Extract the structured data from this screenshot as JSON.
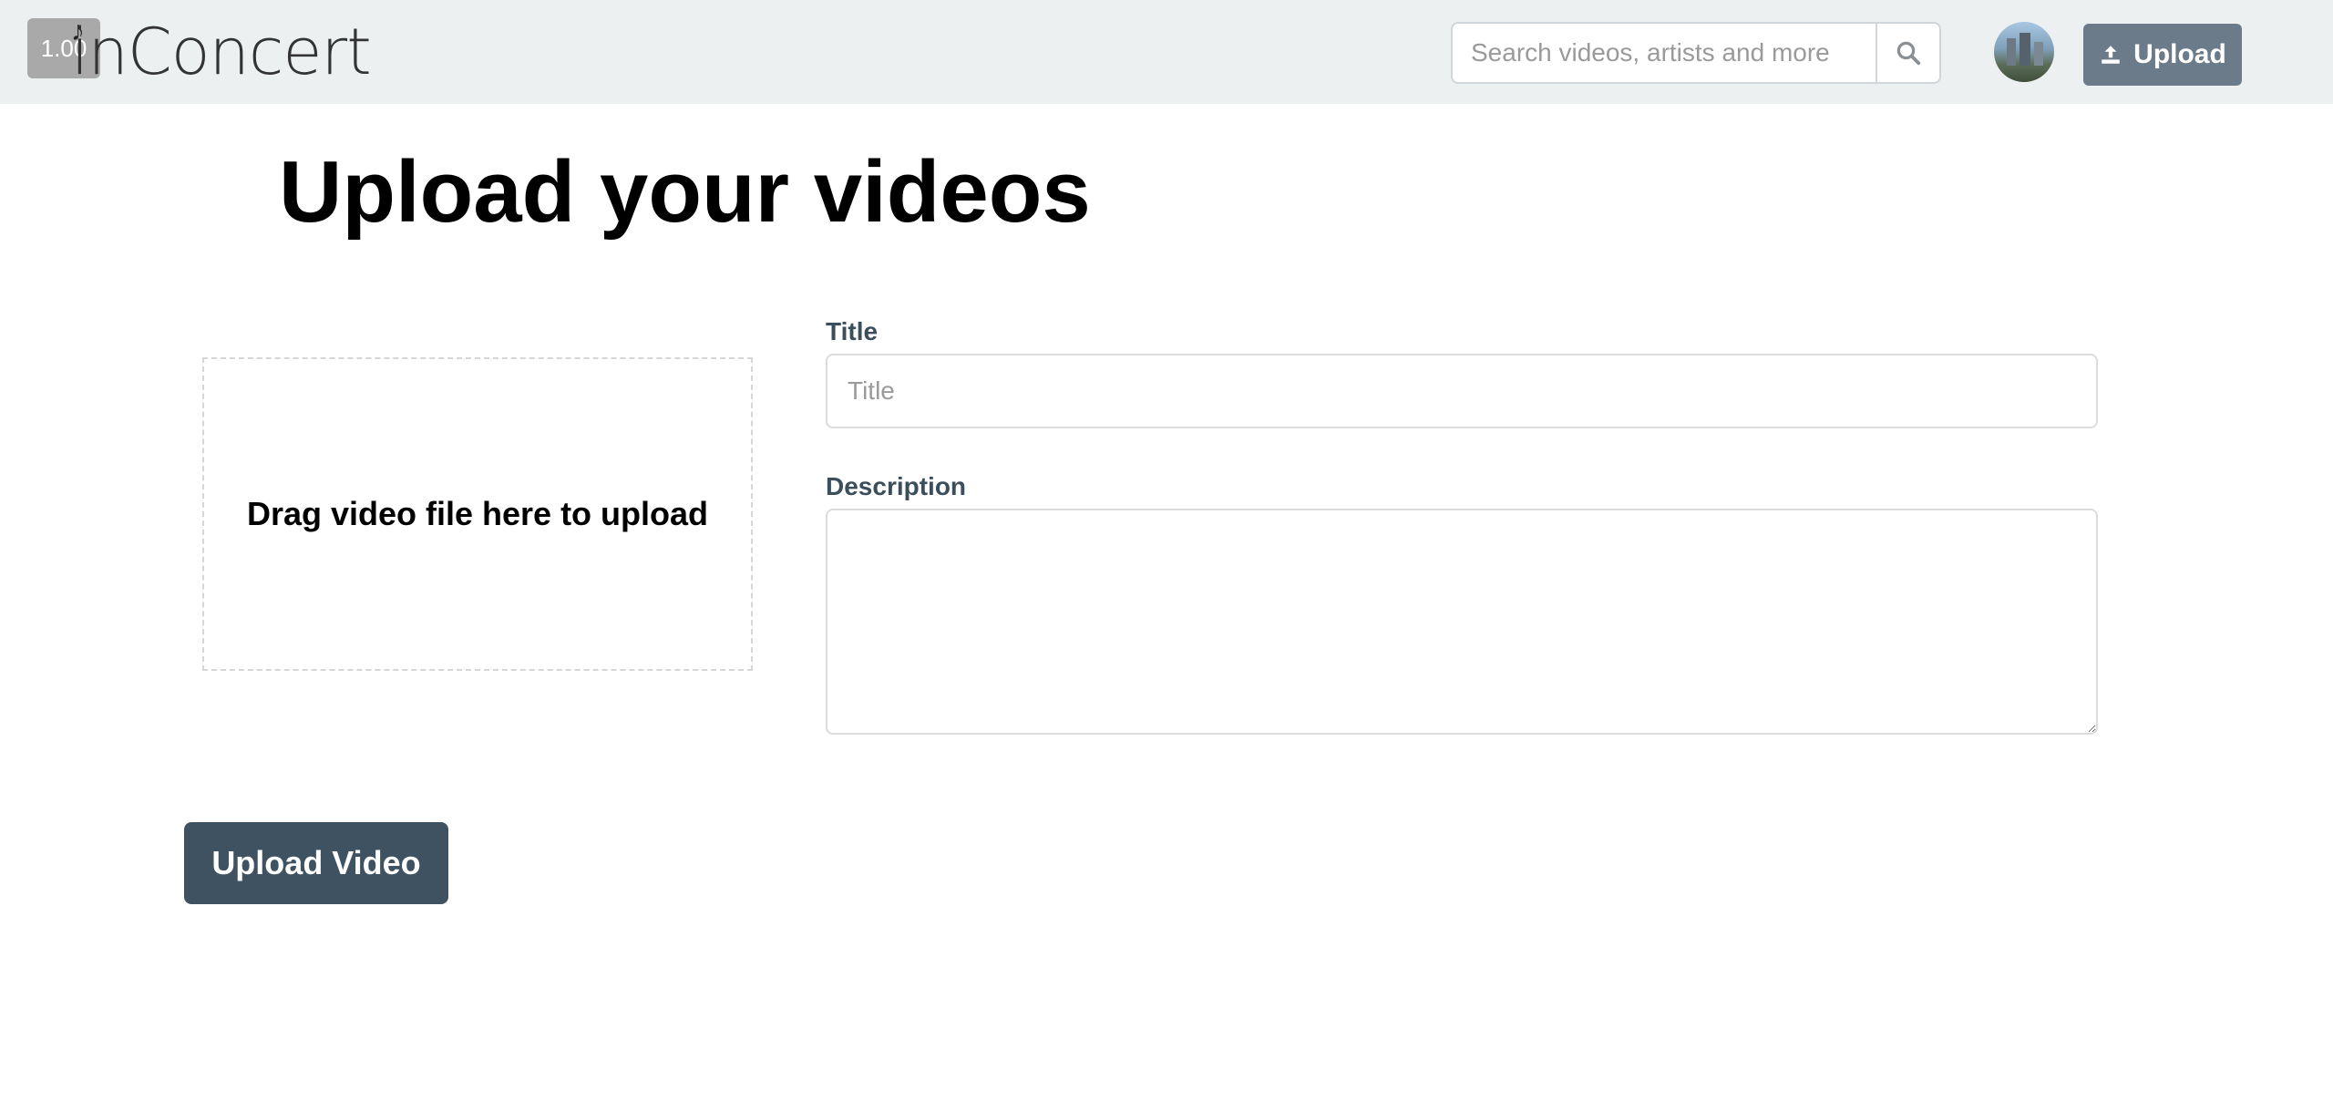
{
  "header": {
    "logo_badge": "1.00",
    "logo_text": "inConcert",
    "logo_icon": "music-note-icon",
    "search": {
      "placeholder": "Search videos, artists and more",
      "value": "",
      "icon": "search-icon"
    },
    "avatar_icon": "user-avatar",
    "upload_button": {
      "label": "Upload",
      "icon": "upload-icon"
    }
  },
  "main": {
    "title": "Upload your videos",
    "dropzone_text": "Drag video file here to upload",
    "form": {
      "title_label": "Title",
      "title_placeholder": "Title",
      "title_value": "",
      "description_label": "Description",
      "description_value": ""
    },
    "submit_label": "Upload Video"
  },
  "colors": {
    "header_bg": "#ecf0f1",
    "primary_button": "#3e5261",
    "secondary_button": "#6b7b89",
    "label_color": "#3b4e5c"
  }
}
